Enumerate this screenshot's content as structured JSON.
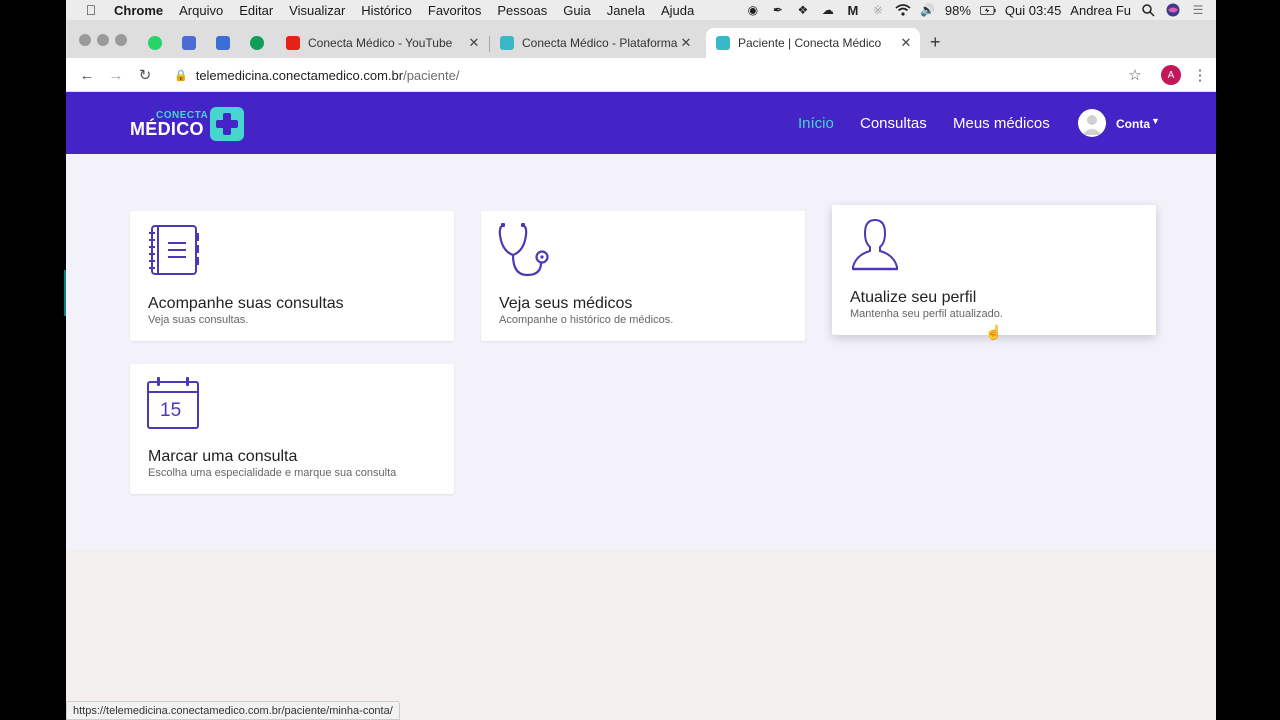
{
  "menubar": {
    "app": "Chrome",
    "items": [
      "Arquivo",
      "Editar",
      "Visualizar",
      "Histórico",
      "Favoritos",
      "Pessoas",
      "Guia",
      "Janela",
      "Ajuda"
    ],
    "battery": "98%",
    "clock": "Qui 03:45",
    "user": "Andrea Fu"
  },
  "tabs": [
    {
      "title": "Conecta Médico - YouTube",
      "favicon_color": "#e62117"
    },
    {
      "title": "Conecta Médico - Plataforma d",
      "favicon_color": "#39b8c9"
    },
    {
      "title": "Paciente | Conecta Médico",
      "favicon_color": "#39b8c9",
      "active": true
    }
  ],
  "pinned_tabs": [
    {
      "icon": "whatsapp-icon",
      "color": "#25d366"
    },
    {
      "icon": "pocket-icon",
      "color": "#4a6cd4"
    },
    {
      "icon": "trello-icon",
      "color": "#3b6fd6"
    },
    {
      "icon": "hangouts-icon",
      "color": "#0f9d58"
    }
  ],
  "address": {
    "host": "telemedicina.conectamedico.com.br",
    "path": "/paciente/"
  },
  "profile_initial": "A",
  "site": {
    "logo_top": "CONECTA",
    "logo_main": "MÉDICO",
    "nav": [
      {
        "label": "Início",
        "active": true
      },
      {
        "label": "Consultas"
      },
      {
        "label": "Meus médicos"
      }
    ],
    "account": "Conta"
  },
  "cards": [
    {
      "icon": "notebook-icon",
      "title": "Acompanhe suas consultas",
      "subtitle": "Veja suas consultas."
    },
    {
      "icon": "stethoscope-icon",
      "title": "Veja seus médicos",
      "subtitle": "Acompanhe o histórico de médicos."
    },
    {
      "icon": "user-profile-icon",
      "title": "Atualize seu perfil",
      "subtitle": "Mantenha seu perfil atualizado."
    },
    {
      "icon": "calendar-icon",
      "title": "Marcar uma consulta",
      "subtitle": "Escolha uma especialidade e marque sua consulta",
      "calendar_day": "15"
    }
  ],
  "status_url": "https://telemedicina.conectamedico.com.br/paciente/minha-conta/",
  "colors": {
    "brand": "#4423c7",
    "accent": "#46d5cf",
    "icon_stroke": "#4a3ab5"
  }
}
